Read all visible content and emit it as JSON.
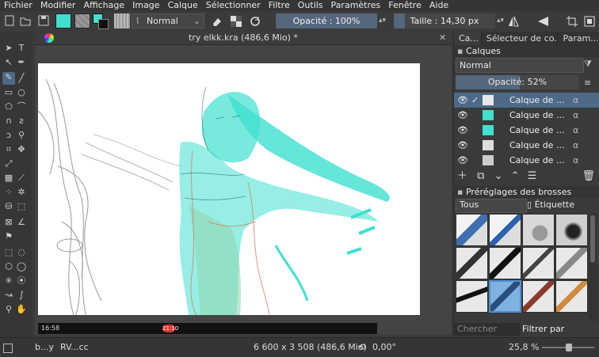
{
  "menu": [
    "Fichier",
    "Modifier",
    "Affichage",
    "Image",
    "Calque",
    "Sélectionner",
    "Filtre",
    "Outils",
    "Paramètres",
    "Fenêtre",
    "Aide"
  ],
  "toolbar": {
    "blend_mode": "Normal",
    "opacity": "Opacité : 100%",
    "size": "Taille : 14,30 px"
  },
  "document": {
    "tab_title": "try elkk.kra (486,6 Mio) *",
    "phone_time": "16:58",
    "phone_pill": "21:10"
  },
  "right_tabs": [
    "Ca...",
    "Sélecteur de co...",
    "Param..."
  ],
  "layers": {
    "title": "Calques",
    "blend_mode": "Normal",
    "opacity_label": "Opacité:",
    "opacity_value": "52%",
    "items": [
      "Calque de ...",
      "Calque de ...",
      "Calque de ...",
      "Calque de ...",
      "Calque de ..."
    ]
  },
  "brushes": {
    "title": "Préréglages des brosses",
    "filter": "Tous",
    "tag_label": "Étiquette",
    "search_placeholder": "Chercher",
    "filter_by_tag": "Filtrer par étiquette"
  },
  "status": {
    "left1": "b...y",
    "left2": "RV...cc",
    "dimensions": "6 600 x 3 508 (486,6 Mio)",
    "rotation": "0,00°",
    "zoom": "25,8 %"
  },
  "colors": {
    "accent": "#56667b",
    "line_art_cyan": "#3fe0cf",
    "highlight": "#4c6a88"
  }
}
